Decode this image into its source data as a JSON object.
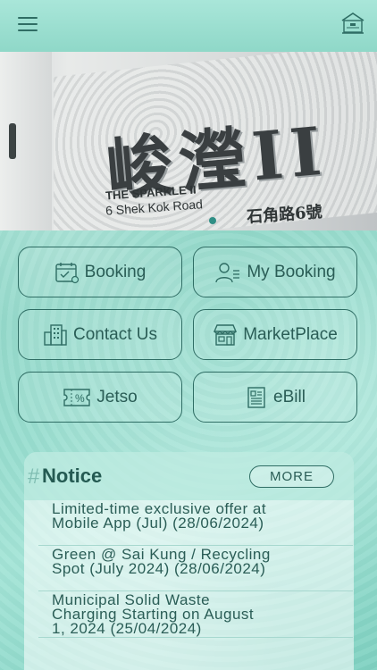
{
  "header": {
    "menu_icon": "hamburger-menu-icon",
    "logo_icon": "building-home-icon"
  },
  "banner": {
    "sign_cn": "峻瀅II",
    "sign_en": "THE SPARKLE II",
    "sign_road": "6 Shek Kok Road",
    "sign_road_cn": "石角路6號",
    "active_slide": 1
  },
  "tiles": [
    {
      "label": "Booking",
      "icon": "calendar-icon"
    },
    {
      "label": "My Booking",
      "icon": "user-list-icon"
    },
    {
      "label": "Contact Us",
      "icon": "building-icon"
    },
    {
      "label": "MarketPlace",
      "icon": "storefront-icon"
    },
    {
      "label": "Jetso",
      "icon": "discount-ticket-icon"
    },
    {
      "label": "eBill",
      "icon": "bill-document-icon"
    }
  ],
  "notice": {
    "title": "Notice",
    "more_label": "MORE",
    "items": [
      {
        "line1": "Limited-time exclusive offer at",
        "line2": "Mobile App (Jul) (28/06/2024)"
      },
      {
        "line1": "Green @ Sai Kung / Recycling",
        "line2": "Spot (July 2024) (28/06/2024)"
      },
      {
        "line1": "Municipal Solid Waste",
        "line2": "Charging Starting on August",
        "line3": "1, 2024 (25/04/2024)"
      }
    ]
  },
  "colors": {
    "accent": "#2f6d64",
    "background": "#8ad6c6"
  }
}
